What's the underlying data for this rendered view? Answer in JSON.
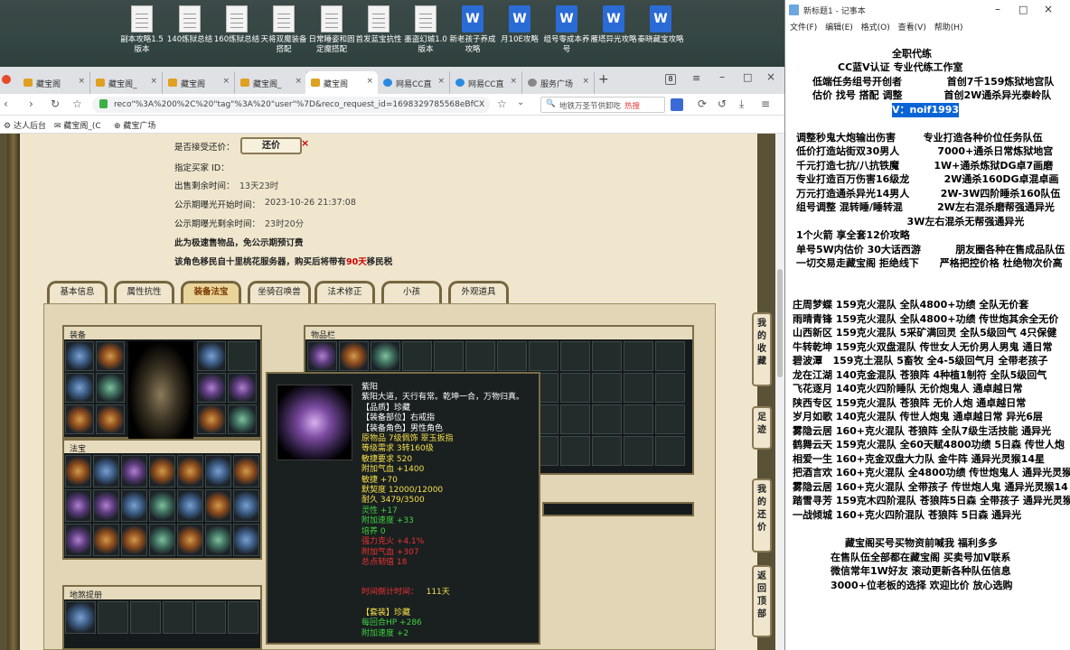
{
  "desktop": {
    "icons": [
      {
        "label": "副本攻略1.5 版本",
        "type": "file"
      },
      {
        "label": "140炼狱总结",
        "type": "file"
      },
      {
        "label": "160炼狱总结",
        "type": "file"
      },
      {
        "label": "天将双魔装备搭配",
        "type": "file"
      },
      {
        "label": "日常睡姿和固定魔搭配",
        "type": "file"
      },
      {
        "label": "首发蓝宝抗性",
        "type": "file"
      },
      {
        "label": "墨盗幻城1.0 版本",
        "type": "file"
      },
      {
        "label": "新老孩子养成攻略",
        "type": "word"
      },
      {
        "label": "月10E攻略",
        "type": "word"
      },
      {
        "label": "组号零成本养号",
        "type": "word"
      },
      {
        "label": "雁塔异光攻略",
        "type": "word"
      },
      {
        "label": "秦晓藏宝攻略",
        "type": "word"
      }
    ]
  },
  "browser": {
    "tabs": [
      "藏宝阁",
      "藏宝阁_",
      "藏宝阁",
      "藏宝阁_",
      "藏宝阁",
      "网易CC直",
      "网易CC直",
      "服务广场"
    ],
    "tab_count": "8",
    "url": "reco\"%3A%200%2C%20\"tag\"%3A%20\"user\"%7D&reco_request_id=1698329785568eBfCX",
    "search": "地铁万圣节供卸吃",
    "search_badge": "热搜",
    "bookmarks": [
      "达人后台",
      "藏宝阁_(C",
      "藏宝广场"
    ]
  },
  "game": {
    "fields": {
      "bargain_label": "是否接受还价：",
      "bargain_button": "还价",
      "buyer_label": "指定买家 ID：",
      "remain_label": "出售剩余时间：",
      "remain_value": "13天23时",
      "pub_start_label": "公示期曝光开始时间：",
      "pub_start_value": "2023-10-26 21:37:08",
      "pub_remain_label": "公示期曝光剩余时间：",
      "pub_remain_value": "23时20分",
      "fast_note": "此为极速售物品，免公示期预订费",
      "move_pre": "该角色移民自十里桃花服务器，购买后将带有",
      "move_days": "90天",
      "move_post": "移民税"
    },
    "tabs": [
      "基本信息",
      "属性抗性",
      "装备法宝",
      "坐骑召唤兽",
      "法术修正",
      "小孩",
      "外观道具"
    ],
    "active_tab": "装备法宝",
    "sections": {
      "equip": "装备",
      "magic": "法宝",
      "items": "物品栏",
      "land": "地煞提册"
    },
    "side_buttons": [
      "我的收藏",
      "足迹",
      "我的还价",
      "返回顶部"
    ],
    "tooltip": {
      "name": "紫阳",
      "desc": "紫阳大道，天行有常。乾坤一合，万物归真。",
      "lines_white": [
        "【品质】珍藏",
        "【装备部位】右戒指",
        "【装备角色】男性角色"
      ],
      "lines_yellow": [
        "原物品 7级佩饰 翠玉扳指",
        "等级需求 3转160级",
        "敏捷要求 520",
        "附加气血 +1400",
        "敏捷 +70",
        "默契度 12000/12000",
        "耐久 3479/3500"
      ],
      "lines_green": [
        "灵性 +17",
        "附加速度 +33",
        "培养 0"
      ],
      "lines_red": [
        "强力克火 +4.1%",
        "附加气血 +307",
        "总点韧值 18"
      ],
      "time_label": "时间倒计时间：",
      "time_value": "111天",
      "set_label": "【套装】珍藏",
      "set_lines": [
        "每回合HP +286",
        "附加速度 +2"
      ]
    }
  },
  "notepad": {
    "title": "新标题1 - 记事本",
    "menu": [
      "文件(F)",
      "编辑(E)",
      "格式(O)",
      "查看(V)",
      "帮助(H)"
    ],
    "lines": [
      "全职代练",
      "CC蓝V认证 专业代练工作室",
      "低端任务组号开创者             首创7千159炼狱地宫队",
      "估价 找号 搭配 调整            首创2W通杀异光泰岭队",
      "V：noif1993",
      "调整秒鬼大炮输出伤害        专业打造各种价位任务队伍",
      "低价打造站街双30男人           7000+通杀日常炼狱地宫",
      "千元打造七抗/八抗铁魔          1W+通杀炼狱DG卓7画磨",
      "专业打造百万伤害16级龙          2W通杀160DG卓混卓画",
      "万元打造通杀异光14男人         2W-3W四阶睡杀160队伍",
      "组号调整 混转睡/睡转混          2W左右混杀磨帮强通异光",
      "                                3W左右混杀无帮强通异光",
      "1个火箭 享全套12价攻略",
      "单号5W内估价 30大话西游          朋友圈各种在售成品队伍",
      "一切交易走藏宝阁 拒绝线下      严格把控价格 杜绝物次价高",
      "庄周梦蝶 159克火混队 全队4800+功绩 全队无价套",
      "雨晴青锋 159克火混队 全队4800+功绩 传世炮其余全无价",
      "山西新区 159克火混队 5采矿满回灵 全队5级回气 4只保健",
      "牛转乾坤 159克火双盘混队 传世女人无价男人男鬼 通日常",
      "碧波潭   159克土混队 5畜牧 全4-5级回气月 全带老孩子",
      "龙在江湖 140克金混队 苍狼阵 4种植1制符 全队5级回气",
      "飞花逐月 140克火四阶睡队 无价炮鬼人 通卓越日常",
      "陕西专区 159克火混队 苍狼阵 无价人炮 通卓越日常",
      "岁月如歌 140克火混队 传世人炮鬼 通卓越日常 异光6层",
      "雾隐云居 160+克火混队 苍狼阵 全队7级生活技能 通异光",
      "鹤舞云天 159克火混队 全60天赋4800功绩 5日森 传世人炮",
      "相爱一生 160+克金双盘大力队 金牛阵 通异光灵猴14星",
      "把酒言欢 160+克火混队 全4800功绩 传世炮鬼人 通异光灵猴",
      "雾隐云居 160+克火混队 全带孩子 传世炮人鬼 通异光灵猴14",
      "踏雪寻芳 159克木四阶混队 苍狼阵5日森 全带孩子 通异光灵猴",
      "一战倾城 160+克火四阶混队 苍狼阵 5日森 通异光",
      "藏宝阁买号买物资前喊我 福利多多",
      "在售队伍全部都在藏宝阁 买卖号加V联系",
      "微信常年1W好友 滚动更新各种队伍信息",
      "3000+位老板的选择 欢迎比价 放心选购"
    ]
  }
}
